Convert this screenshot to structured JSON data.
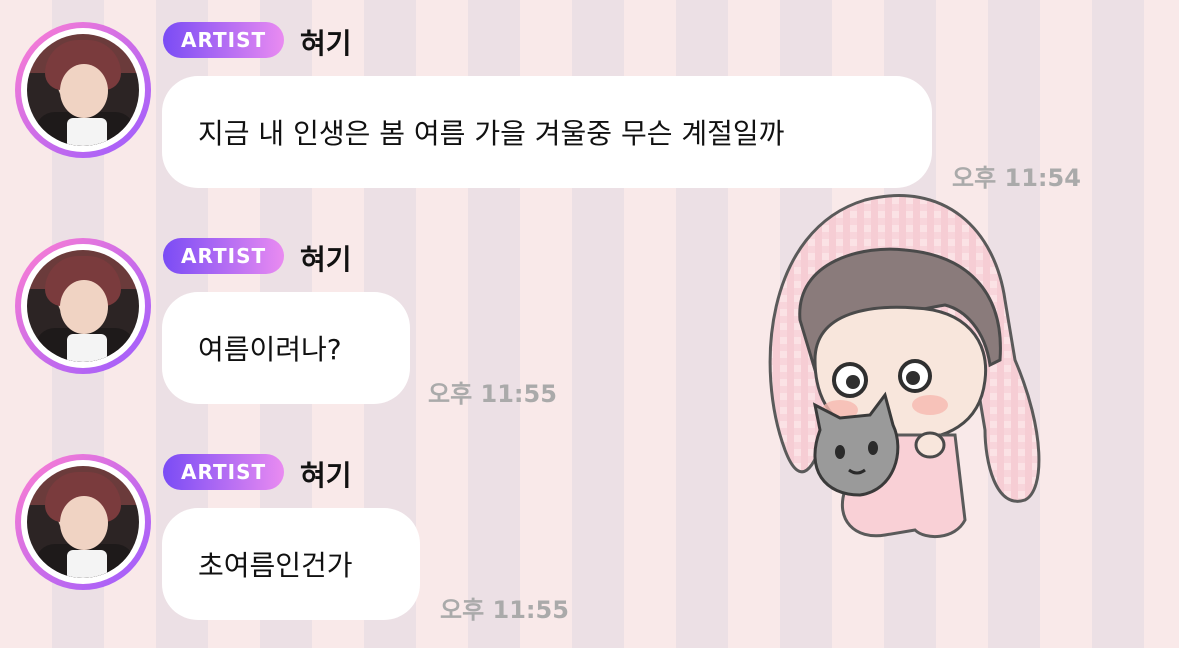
{
  "messages": [
    {
      "badge": "ARTIST",
      "name": "혀기",
      "text": "지금 내 인생은 봄 여름 가을 겨울중 무슨 계절일까",
      "time": "오후 11:54"
    },
    {
      "badge": "ARTIST",
      "name": "혀기",
      "text": "여름이려나?",
      "time": "오후 11:55"
    },
    {
      "badge": "ARTIST",
      "name": "혀기",
      "text": "초여름인건가",
      "time": "오후 11:55"
    }
  ],
  "colors": {
    "badge_start": "#7a4cf5",
    "badge_end": "#e98bf1",
    "time": "#aaaaaa"
  },
  "icons": {
    "sticker": "chibi-bunny-hood-with-cat-sticker"
  }
}
